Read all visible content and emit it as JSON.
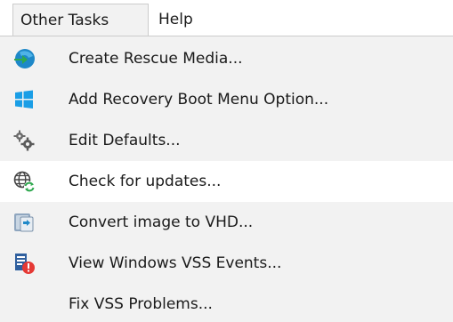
{
  "menubar": {
    "tabs": [
      {
        "label": "Other Tasks"
      },
      {
        "label": "Help"
      }
    ]
  },
  "dropdown": {
    "items": [
      {
        "label": "Create Rescue Media...",
        "icon": "rescue-media-icon"
      },
      {
        "label": "Add Recovery Boot Menu Option...",
        "icon": "windows-logo-icon"
      },
      {
        "label": "Edit Defaults...",
        "icon": "gears-icon"
      },
      {
        "label": "Check for updates...",
        "icon": "globe-update-icon"
      },
      {
        "label": "Convert image to VHD...",
        "icon": "vhd-convert-icon"
      },
      {
        "label": "View Windows VSS Events...",
        "icon": "vss-events-warning-icon"
      },
      {
        "label": "Fix VSS Problems...",
        "icon": ""
      }
    ]
  },
  "colors": {
    "menu_background": "#f2f2f2",
    "highlight_background": "#ffffff",
    "text": "#1a1a1a",
    "border": "#cccccc",
    "windows_blue": "#1a9ee6",
    "rescue_blue": "#1e88c8",
    "rescue_green": "#2fa84f",
    "warning_red": "#e53935"
  }
}
